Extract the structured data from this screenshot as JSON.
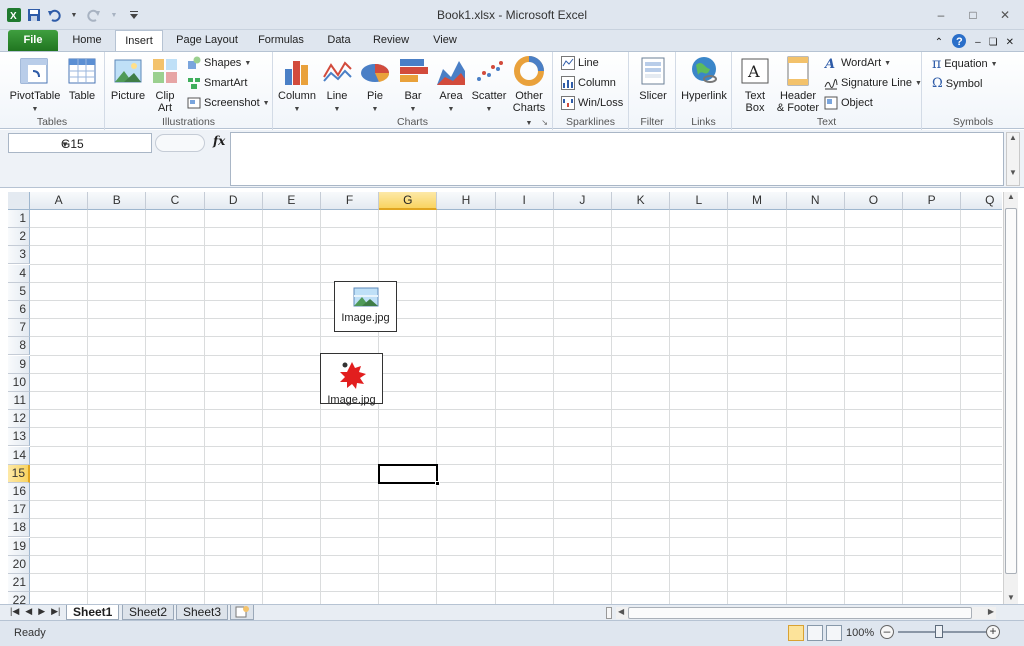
{
  "window": {
    "title": "Book1.xlsx  -  Microsoft Excel"
  },
  "tabs": {
    "file": "File",
    "items": [
      "Home",
      "Insert",
      "Page Layout",
      "Formulas",
      "Data",
      "Review",
      "View"
    ],
    "active": "Insert"
  },
  "ribbon": {
    "tables": {
      "label": "Tables",
      "pivottable": "PivotTable",
      "table": "Table"
    },
    "illustrations": {
      "label": "Illustrations",
      "picture": "Picture",
      "clipart_line1": "Clip",
      "clipart_line2": "Art",
      "shapes": "Shapes",
      "smartart": "SmartArt",
      "screenshot": "Screenshot"
    },
    "charts": {
      "label": "Charts",
      "column": "Column",
      "line": "Line",
      "pie": "Pie",
      "bar": "Bar",
      "area": "Area",
      "scatter": "Scatter",
      "other_line1": "Other",
      "other_line2": "Charts"
    },
    "sparklines": {
      "label": "Sparklines",
      "line": "Line",
      "column": "Column",
      "winloss": "Win/Loss"
    },
    "filter": {
      "label": "Filter",
      "slicer": "Slicer"
    },
    "links": {
      "label": "Links",
      "hyperlink": "Hyperlink"
    },
    "text": {
      "label": "Text",
      "textbox_line1": "Text",
      "textbox_line2": "Box",
      "header_line1": "Header",
      "header_line2": "& Footer",
      "wordart": "WordArt",
      "signature": "Signature Line",
      "object": "Object"
    },
    "symbols": {
      "label": "Symbols",
      "equation": "Equation",
      "symbol": "Symbol"
    }
  },
  "formula_bar": {
    "name_box": "G15",
    "fx": "fx",
    "value": ""
  },
  "grid": {
    "columns": [
      "A",
      "B",
      "C",
      "D",
      "E",
      "F",
      "G",
      "H",
      "I",
      "J",
      "K",
      "L",
      "M",
      "N",
      "O",
      "P",
      "Q"
    ],
    "rows": [
      "1",
      "2",
      "3",
      "4",
      "5",
      "6",
      "7",
      "8",
      "9",
      "10",
      "11",
      "12",
      "13",
      "14",
      "15",
      "16",
      "17",
      "18",
      "19",
      "20",
      "21",
      "22"
    ],
    "selected_cell": "G15",
    "selected_column": "G",
    "selected_row": "15",
    "objects": [
      {
        "label": "Image.jpg",
        "icon": "landscape-image-icon"
      },
      {
        "label": "Image.jpg",
        "icon": "red-splat-icon"
      }
    ]
  },
  "sheets": {
    "tabs": [
      "Sheet1",
      "Sheet2",
      "Sheet3"
    ],
    "active": "Sheet1"
  },
  "status": {
    "text": "Ready",
    "zoom": "100%",
    "zoom_percent": 100
  },
  "colors": {
    "file_tab": "#2a8a2a",
    "selection_header": "#f9d461",
    "gridline": "#dadcdd"
  }
}
